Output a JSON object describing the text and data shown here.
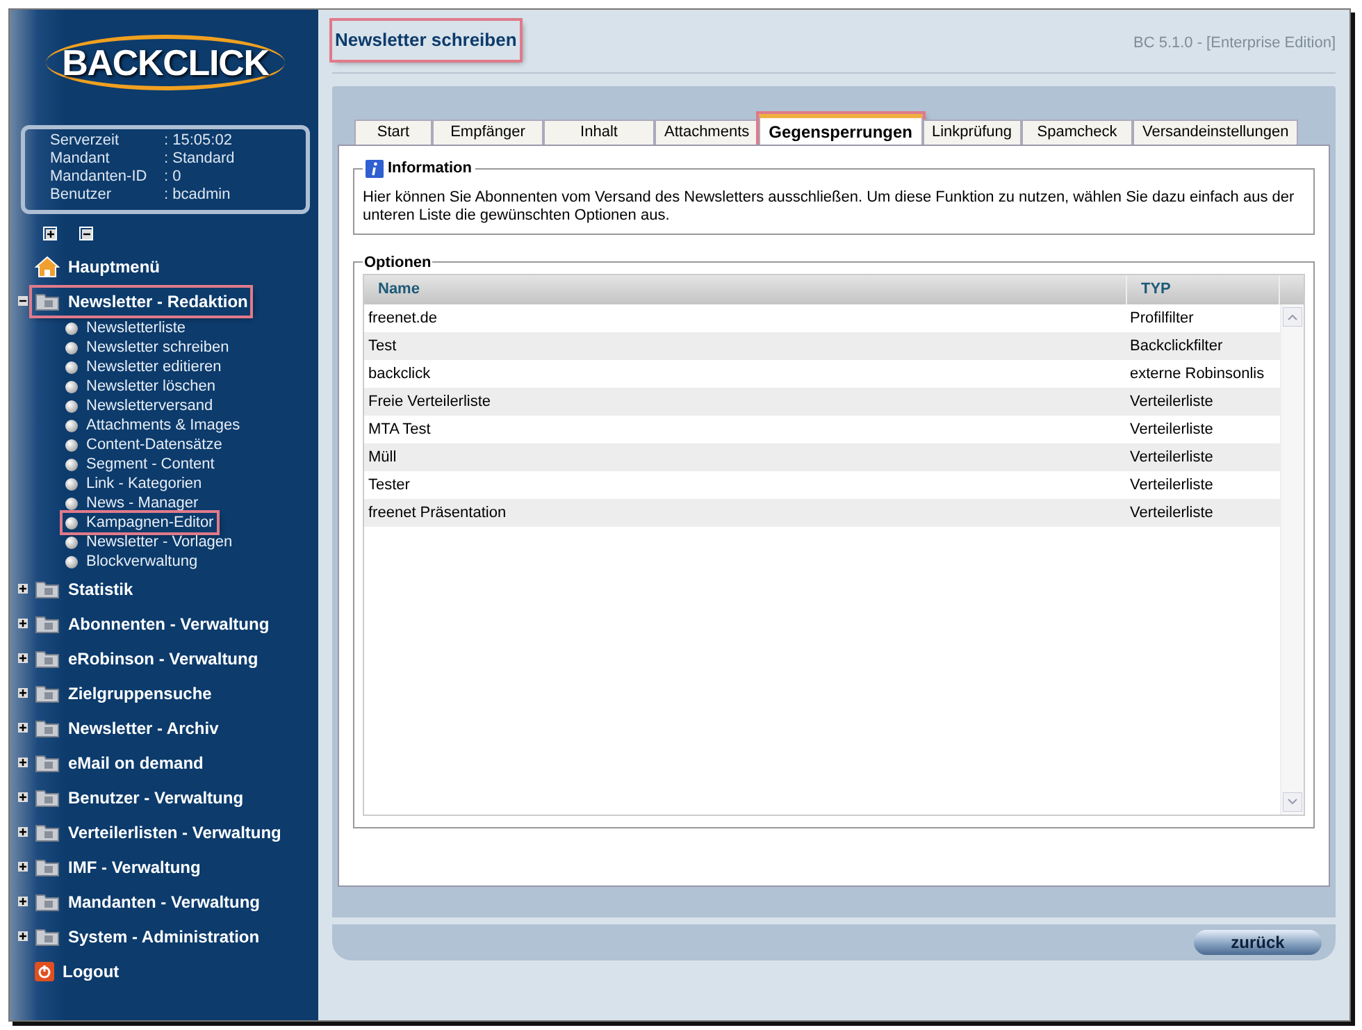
{
  "sidebar": {
    "logo": "BACKCLICK",
    "info": [
      {
        "label": "Serverzeit",
        "value": ": 15:05:02"
      },
      {
        "label": "Mandant",
        "value": ": Standard"
      },
      {
        "label": "Mandanten-ID",
        "value": ": 0"
      },
      {
        "label": "Benutzer",
        "value": ": bcadmin"
      }
    ],
    "menu": [
      {
        "kind": "home",
        "label": "Hauptmenü",
        "highlighted": false
      },
      {
        "kind": "folder",
        "label": "Newsletter - Redaktion",
        "expanded": true,
        "highlighted": true,
        "children": [
          {
            "label": "Newsletterliste",
            "highlighted": false
          },
          {
            "label": "Newsletter schreiben",
            "highlighted": false
          },
          {
            "label": "Newsletter editieren",
            "highlighted": false
          },
          {
            "label": "Newsletter löschen",
            "highlighted": false
          },
          {
            "label": "Newsletterversand",
            "highlighted": false
          },
          {
            "label": "Attachments & Images",
            "highlighted": false
          },
          {
            "label": "Content-Datensätze",
            "highlighted": false
          },
          {
            "label": "Segment - Content",
            "highlighted": false
          },
          {
            "label": "Link - Kategorien",
            "highlighted": false
          },
          {
            "label": "News - Manager",
            "highlighted": false
          },
          {
            "label": "Kampagnen-Editor",
            "highlighted": true
          },
          {
            "label": "Newsletter - Vorlagen",
            "highlighted": false
          },
          {
            "label": "Blockverwaltung",
            "highlighted": false
          }
        ]
      },
      {
        "kind": "folder",
        "label": "Statistik",
        "expanded": false,
        "highlighted": false
      },
      {
        "kind": "folder",
        "label": "Abonnenten - Verwaltung",
        "expanded": false,
        "highlighted": false
      },
      {
        "kind": "folder",
        "label": "eRobinson - Verwaltung",
        "expanded": false,
        "highlighted": false
      },
      {
        "kind": "folder",
        "label": "Zielgruppensuche",
        "expanded": false,
        "highlighted": false
      },
      {
        "kind": "folder",
        "label": "Newsletter - Archiv",
        "expanded": false,
        "highlighted": false
      },
      {
        "kind": "folder",
        "label": "eMail on demand",
        "expanded": false,
        "highlighted": false
      },
      {
        "kind": "folder",
        "label": "Benutzer - Verwaltung",
        "expanded": false,
        "highlighted": false
      },
      {
        "kind": "folder",
        "label": "Verteilerlisten - Verwaltung",
        "expanded": false,
        "highlighted": false
      },
      {
        "kind": "folder",
        "label": "IMF - Verwaltung",
        "expanded": false,
        "highlighted": false
      },
      {
        "kind": "folder",
        "label": "Mandanten - Verwaltung",
        "expanded": false,
        "highlighted": false
      },
      {
        "kind": "folder",
        "label": "System - Administration",
        "expanded": false,
        "highlighted": false
      },
      {
        "kind": "logout",
        "label": "Logout",
        "highlighted": false
      }
    ]
  },
  "page": {
    "title": "Newsletter schreiben",
    "title_highlighted": true,
    "version": "BC 5.1.0 - [Enterprise Edition]"
  },
  "tabs": [
    {
      "label": "Start",
      "selected": false,
      "highlighted": false
    },
    {
      "label": "Empfänger",
      "selected": false,
      "highlighted": false
    },
    {
      "label": "Inhalt",
      "selected": false,
      "highlighted": false
    },
    {
      "label": "Attachments",
      "selected": false,
      "highlighted": false
    },
    {
      "label": "Gegensperrungen",
      "selected": true,
      "highlighted": true
    },
    {
      "label": "Linkprüfung",
      "selected": false,
      "highlighted": false
    },
    {
      "label": "Spamcheck",
      "selected": false,
      "highlighted": false
    },
    {
      "label": "Versandeinstellungen",
      "selected": false,
      "highlighted": false
    }
  ],
  "information": {
    "legend": "Information",
    "text": "Hier können Sie Abonnenten vom Versand des Newsletters ausschließen. Um diese Funktion zu nutzen, wählen Sie dazu einfach aus der unteren Liste die gewünschten Optionen aus."
  },
  "options": {
    "legend": "Optionen",
    "columns": [
      "Name",
      "TYP"
    ],
    "rows": [
      [
        "freenet.de",
        "Profilfilter"
      ],
      [
        "Test",
        "Backclickfilter"
      ],
      [
        "backclick",
        "externe Robinsonlis"
      ],
      [
        "Freie Verteilerliste",
        "Verteilerliste"
      ],
      [
        "MTA Test",
        "Verteilerliste"
      ],
      [
        "Müll",
        "Verteilerliste"
      ],
      [
        "Tester",
        "Verteilerliste"
      ],
      [
        "freenet Präsentation",
        "Verteilerliste"
      ]
    ]
  },
  "back_button": "zurück"
}
